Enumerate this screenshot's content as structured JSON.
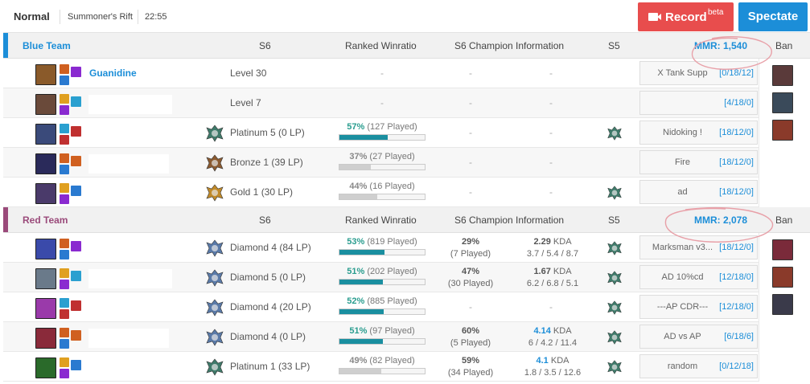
{
  "game": {
    "mode": "Normal",
    "map": "Summoner's Rift",
    "duration": "22:55"
  },
  "buttons": {
    "record": "Record",
    "record_badge": "beta",
    "spectate": "Spectate"
  },
  "columns": {
    "s6": "S6",
    "ranked_winratio": "Ranked Winratio",
    "champion_info": "S6 Champion Information",
    "s5": "S5",
    "ban": "Ban"
  },
  "blue_team": {
    "name": "Blue Team",
    "mmr": "MMR: 1,540",
    "color": "#1c8ed8",
    "players": [
      {
        "champ_color": "#8a5a2a",
        "name": "Guanidine",
        "tier": "Level 30",
        "wr_pct": "",
        "wr_played": "-",
        "wr_fill": 0,
        "champ_wr": "-",
        "champ_games": "",
        "kda": "-",
        "kda_detail": "",
        "s5": false,
        "note": "X Tank Supp",
        "score": "[0/18/12]",
        "tier_icon": ""
      },
      {
        "champ_color": "#6a4a3a",
        "name": "",
        "tier": "Level 7",
        "wr_pct": "",
        "wr_played": "-",
        "wr_fill": 0,
        "champ_wr": "-",
        "champ_games": "",
        "kda": "-",
        "kda_detail": "",
        "s5": false,
        "note": "",
        "score": "[4/18/0]",
        "tier_icon": ""
      },
      {
        "champ_color": "#3a4a7a",
        "name": "",
        "tier": "Platinum 5 (0 LP)",
        "wr_pct": "57%",
        "wr_played": " (127 Played)",
        "wr_fill": 0.57,
        "champ_wr": "-",
        "champ_games": "",
        "kda": "-",
        "kda_detail": "",
        "s5": true,
        "note": "Nidoking !",
        "score": "[18/12/0]",
        "tier_icon": "platinum"
      },
      {
        "champ_color": "#2a2a5a",
        "name": "",
        "tier": "Bronze 1 (39 LP)",
        "wr_pct": "37%",
        "wr_played": " (27 Played)",
        "wr_fill": 0.37,
        "champ_wr": "-",
        "champ_games": "",
        "kda": "-",
        "kda_detail": "",
        "s5": false,
        "note": "Fire",
        "score": "[18/12/0]",
        "tier_icon": "bronze"
      },
      {
        "champ_color": "#4a3a6a",
        "name": "",
        "tier": "Gold 1 (30 LP)",
        "wr_pct": "44%",
        "wr_played": " (16 Played)",
        "wr_fill": 0.44,
        "champ_wr": "-",
        "champ_games": "",
        "kda": "-",
        "kda_detail": "",
        "s5": true,
        "note": "ad",
        "score": "[18/12/0]",
        "tier_icon": "gold"
      }
    ],
    "bans": [
      "#5a3a3a",
      "#3a4a5a",
      "#8a3a2a"
    ]
  },
  "red_team": {
    "name": "Red Team",
    "mmr": "MMR: 2,078",
    "color": "#9a4a7a",
    "players": [
      {
        "champ_color": "#3a4aaa",
        "name": "",
        "tier": "Diamond 4 (84 LP)",
        "wr_pct": "53%",
        "wr_played": " (819 Played)",
        "wr_fill": 0.53,
        "champ_wr": "29%",
        "champ_games": "(7 Played)",
        "kda": "2.29",
        "kda_detail": "3.7 / 5.4 / 8.7",
        "kda_blue": false,
        "s5": true,
        "note": "Marksman v3...",
        "score": "[18/12/0]",
        "tier_icon": "diamond"
      },
      {
        "champ_color": "#6a7a8a",
        "name": "",
        "tier": "Diamond 5 (0 LP)",
        "wr_pct": "51%",
        "wr_played": " (202 Played)",
        "wr_fill": 0.51,
        "champ_wr": "47%",
        "champ_games": "(30 Played)",
        "kda": "1.67",
        "kda_detail": "6.2 / 6.8 / 5.1",
        "kda_blue": false,
        "s5": true,
        "note": "AD 10%cd",
        "score": "[12/18/0]",
        "tier_icon": "diamond"
      },
      {
        "champ_color": "#9a3aaa",
        "name": "",
        "tier": "Diamond 4 (20 LP)",
        "wr_pct": "52%",
        "wr_played": " (885 Played)",
        "wr_fill": 0.52,
        "champ_wr": "-",
        "champ_games": "",
        "kda": "-",
        "kda_detail": "",
        "s5": true,
        "note": "---AP CDR---",
        "score": "[12/18/0]",
        "tier_icon": "diamond"
      },
      {
        "champ_color": "#8a2a3a",
        "name": "",
        "tier": "Diamond 4 (0 LP)",
        "wr_pct": "51%",
        "wr_played": " (97 Played)",
        "wr_fill": 0.51,
        "champ_wr": "60%",
        "champ_games": "(5 Played)",
        "kda": "4.14",
        "kda_detail": "6 / 4.2 / 11.4",
        "kda_blue": true,
        "s5": true,
        "note": "AD vs AP",
        "score": "[6/18/6]",
        "tier_icon": "diamond"
      },
      {
        "champ_color": "#2a6a2a",
        "name": "",
        "tier": "Platinum 1 (33 LP)",
        "wr_pct": "49%",
        "wr_played": " (82 Played)",
        "wr_fill": 0.49,
        "champ_wr": "59%",
        "champ_games": "(34 Played)",
        "kda": "4.1",
        "kda_detail": "1.8 / 3.5 / 12.6",
        "kda_blue": true,
        "s5": true,
        "note": "random",
        "score": "[0/12/18]",
        "tier_icon": "platinum"
      }
    ],
    "bans": [
      "#7a2a3a",
      "#8a3a2a",
      "#3a3a4a"
    ]
  },
  "labels": {
    "kda_suffix": " KDA"
  }
}
